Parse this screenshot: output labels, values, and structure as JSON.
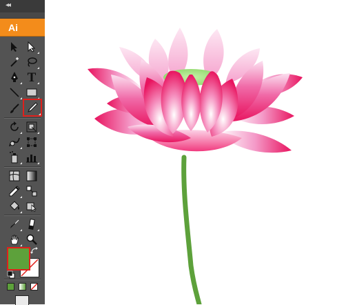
{
  "app": {
    "logo_text": "Ai",
    "panel_collapse_glyph": "◂◂"
  },
  "tools": [
    {
      "name": "selection-tool",
      "icon": "arrow-icon"
    },
    {
      "name": "direct-selection-tool",
      "icon": "white-arrow-icon"
    },
    {
      "name": "magic-wand-tool",
      "icon": "magic-wand-icon"
    },
    {
      "name": "lasso-tool",
      "icon": "lasso-icon"
    },
    {
      "name": "pen-tool",
      "icon": "pen-icon"
    },
    {
      "name": "type-tool",
      "icon": "type-icon",
      "glyph": "T"
    },
    {
      "name": "line-segment-tool",
      "icon": "line-icon"
    },
    {
      "name": "rectangle-tool",
      "icon": "rectangle-icon"
    },
    {
      "name": "paintbrush-tool",
      "icon": "paintbrush-icon"
    },
    {
      "name": "pencil-tool",
      "icon": "pencil-icon",
      "selected": true
    },
    {
      "name": "rotate-tool",
      "icon": "rotate-icon"
    },
    {
      "name": "scale-tool",
      "icon": "scale-icon"
    },
    {
      "name": "warp-tool",
      "icon": "warp-icon"
    },
    {
      "name": "free-transform-tool",
      "icon": "free-transform-icon"
    },
    {
      "name": "symbol-sprayer-tool",
      "icon": "symbol-sprayer-icon"
    },
    {
      "name": "column-graph-tool",
      "icon": "column-graph-icon"
    },
    {
      "name": "mesh-tool",
      "icon": "mesh-icon"
    },
    {
      "name": "gradient-tool",
      "icon": "gradient-icon"
    },
    {
      "name": "eyedropper-tool",
      "icon": "eyedropper-icon"
    },
    {
      "name": "blend-tool",
      "icon": "blend-icon"
    },
    {
      "name": "live-paint-bucket-tool",
      "icon": "paint-bucket-icon"
    },
    {
      "name": "live-paint-selection-tool",
      "icon": "live-paint-selection-icon"
    },
    {
      "name": "slice-tool",
      "icon": "slice-icon"
    },
    {
      "name": "eraser-tool",
      "icon": "eraser-icon"
    },
    {
      "name": "hand-tool",
      "icon": "hand-icon"
    },
    {
      "name": "zoom-tool",
      "icon": "zoom-icon"
    }
  ],
  "colors": {
    "fill": "#5da13b",
    "stroke": "none",
    "highlight": "#e0201b",
    "accent": "#f38c1b"
  },
  "artwork": {
    "subject": "lotus-flower",
    "petal_colors": [
      "#e8145f",
      "#f4a8d0",
      "#ffffff"
    ],
    "seed_pod_color": "#9ee07a",
    "stem_color": "#5da13b"
  }
}
